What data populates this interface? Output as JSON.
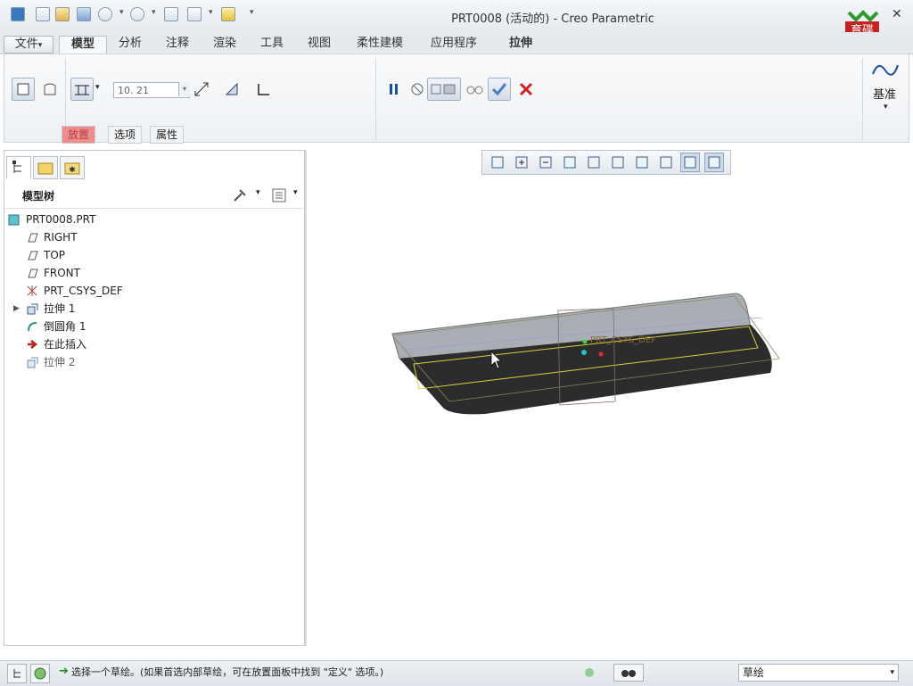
{
  "window": {
    "title": "PRT0008 (活动的) - Creo Parametric",
    "logo_text": "育碟软件"
  },
  "quick_access": [
    "new-icon",
    "open-icon",
    "save-icon",
    "undo-icon",
    "redo-icon",
    "regenerate-icon",
    "windows-icon",
    "close-window-icon",
    "customize-icon"
  ],
  "ribbon_tabs": [
    {
      "label": "文件",
      "dropdown": "▾"
    },
    {
      "label": "模型",
      "active": true
    },
    {
      "label": "分析"
    },
    {
      "label": "注释"
    },
    {
      "label": "渲染"
    },
    {
      "label": "工具"
    },
    {
      "label": "视图"
    },
    {
      "label": "柔性建模"
    },
    {
      "label": "应用程序"
    },
    {
      "label": "拉伸",
      "contextual": true
    }
  ],
  "ribbon": {
    "depth_value": "10. 21",
    "subtabs": [
      "放置",
      "选项",
      "属性"
    ],
    "datum_label": "基准"
  },
  "left_pane": {
    "tree_title": "模型树",
    "items": [
      {
        "label": "PRT0008.PRT",
        "icon": "part-icon",
        "indent": 0
      },
      {
        "label": "RIGHT",
        "icon": "datum-plane-icon",
        "indent": 1
      },
      {
        "label": "TOP",
        "icon": "datum-plane-icon",
        "indent": 1
      },
      {
        "label": "FRONT",
        "icon": "datum-plane-icon",
        "indent": 1
      },
      {
        "label": "PRT_CSYS_DEF",
        "icon": "csys-icon",
        "indent": 1
      },
      {
        "label": "拉伸 1",
        "icon": "extrude-icon",
        "indent": 1,
        "expandable": true
      },
      {
        "label": "倒圆角 1",
        "icon": "round-icon",
        "indent": 1
      },
      {
        "label": "在此插入",
        "icon": "insert-arrow-icon",
        "indent": 1
      },
      {
        "label": "拉伸 2",
        "icon": "extrude-icon",
        "indent": 1,
        "ghost": true
      }
    ]
  },
  "graphics": {
    "csys_label": "PRT_CSYS_DEF"
  },
  "status": {
    "message": "选择一个草绘。(如果首选内部草绘，可在放置面板中找到 \"定义\" 选项。)",
    "filter": "草绘"
  },
  "colors": {
    "accent": "#1a4fa3",
    "cancel_red": "#d22020",
    "ok_blue": "#4a7fc0",
    "highlight_tab": "#ef8c8c",
    "model_dark": "#2c2c2c",
    "model_light": "#a9aeb4"
  }
}
